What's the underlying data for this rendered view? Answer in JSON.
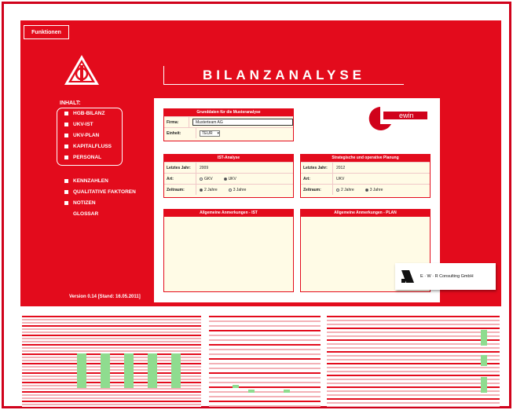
{
  "toolbar": {
    "functions_label": "Funktionen"
  },
  "header": {
    "title": "BILANZANALYSE"
  },
  "sidebar": {
    "heading": "INHALT:",
    "items": [
      {
        "label": "HGB-BILANZ"
      },
      {
        "label": "UKV-IST"
      },
      {
        "label": "UKV-PLAN"
      },
      {
        "label": "KAPITALFLUSS"
      },
      {
        "label": "PERSONAL"
      },
      {
        "label": "KENNZAHLEN"
      },
      {
        "label": "QUALITATIVE FAKTOREN"
      },
      {
        "label": "NOTIZEN"
      },
      {
        "label": "GLOSSAR"
      }
    ],
    "version": "Version 0.14 [Stand: 16.05.2011]"
  },
  "grunddaten": {
    "title": "Grunddaten für die Musteranalyse",
    "firma_label": "Firma:",
    "firma_value": "Musterteam AG",
    "einheit_label": "Einheit:",
    "einheit_value": "TEUR"
  },
  "ist": {
    "title": "IST-Analyse",
    "jahr_label": "Letztes Jahr:",
    "jahr_value": "2009",
    "art_label": "Art:",
    "art_options": [
      "GKV",
      "UKV"
    ],
    "zeitraum_label": "Zeitraum:",
    "zeitraum_options": [
      "2 Jahre",
      "3 Jahre"
    ]
  },
  "plan": {
    "title": "Strategische und operative Planung",
    "jahr_label": "Letztes Jahr:",
    "jahr_value": "2012",
    "art_label": "Art:",
    "art_value": "UKV",
    "zeitraum_label": "Zeitraum:",
    "zeitraum_options": [
      "2 Jahre",
      "3 Jahre"
    ]
  },
  "notes": {
    "ist_title": "Allgemeine Anmerkungen - IST",
    "plan_title": "Allgemeine Anmerkungen - PLAN"
  },
  "brand": {
    "ewin_text": "ewin",
    "ewr_text": "E · W · R  Consulting GmbH"
  },
  "colors": {
    "brand_red": "#e30b1c",
    "panel_bg": "#fffbe6"
  }
}
